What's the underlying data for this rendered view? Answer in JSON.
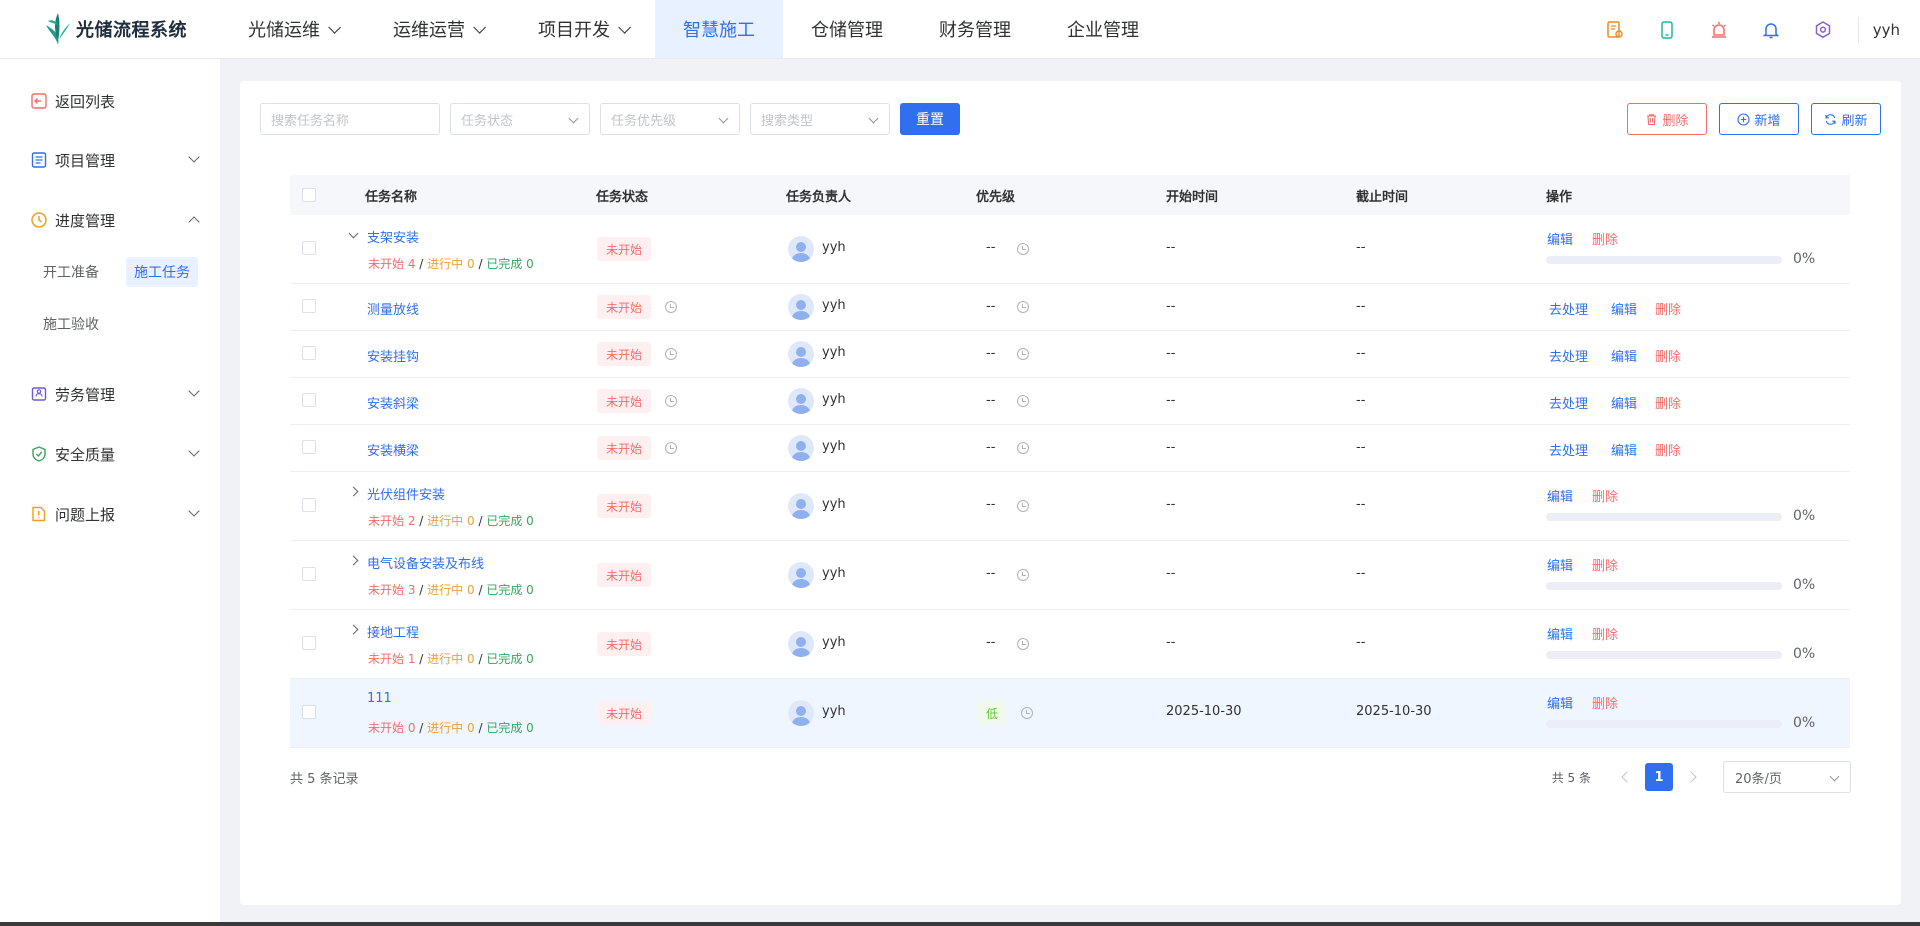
{
  "app": {
    "title": "光储流程系统",
    "user": "yyh"
  },
  "topnav": [
    {
      "label": "光储运维",
      "has_chevron": true
    },
    {
      "label": "运维运营",
      "has_chevron": true
    },
    {
      "label": "项目开发",
      "has_chevron": true
    },
    {
      "label": "智慧施工",
      "has_chevron": false,
      "active": true
    },
    {
      "label": "仓储管理",
      "has_chevron": false
    },
    {
      "label": "财务管理",
      "has_chevron": false
    },
    {
      "label": "企业管理",
      "has_chevron": false
    }
  ],
  "top_icons": [
    "map-pin-icon",
    "mobile-icon",
    "alarm-icon",
    "bell-icon",
    "settings-icon"
  ],
  "sidebar": {
    "back": "返回列表",
    "items": [
      {
        "label": "项目管理",
        "icon": "list-icon",
        "expanded": false
      },
      {
        "label": "进度管理",
        "icon": "clock-icon",
        "expanded": true
      },
      {
        "label": "劳务管理",
        "icon": "worker-icon",
        "expanded": false
      },
      {
        "label": "安全质量",
        "icon": "shield-icon",
        "expanded": false
      },
      {
        "label": "问题上报",
        "icon": "report-icon",
        "expanded": false
      }
    ],
    "sub_items": [
      {
        "label": "开工准备",
        "active": false
      },
      {
        "label": "施工任务",
        "active": true
      },
      {
        "label": "施工验收",
        "active": false
      }
    ]
  },
  "filters": {
    "task_name_placeholder": "搜索任务名称",
    "status_placeholder": "任务状态",
    "priority_placeholder": "任务优先级",
    "type_placeholder": "搜索类型",
    "reset_label": "重置"
  },
  "actions": {
    "delete": "删除",
    "add": "新增",
    "refresh": "刷新"
  },
  "table": {
    "headers": [
      "任务名称",
      "任务状态",
      "任务负责人",
      "优先级",
      "开始时间",
      "截止时间",
      "操作"
    ],
    "ops": {
      "handle": "去处理",
      "edit": "编辑",
      "delete": "删除"
    },
    "count_labels": {
      "not_started": "未开始",
      "in_progress": "进行中",
      "done": "已完成"
    },
    "rows": [
      {
        "name": "支架安装",
        "parent": true,
        "expander": "down",
        "status": "未开始",
        "owner": "yyh",
        "priority": "--",
        "start": "--",
        "end": "--",
        "not_started": "4",
        "in_progress": "0",
        "done": "0",
        "progress_pct": "0%",
        "progress": 0
      },
      {
        "name": "测量放线",
        "child": true,
        "status": "未开始",
        "owner": "yyh",
        "priority": "--",
        "start": "--",
        "end": "--"
      },
      {
        "name": "安装挂钩",
        "child": true,
        "status": "未开始",
        "owner": "yyh",
        "priority": "--",
        "start": "--",
        "end": "--"
      },
      {
        "name": "安装斜梁",
        "child": true,
        "status": "未开始",
        "owner": "yyh",
        "priority": "--",
        "start": "--",
        "end": "--"
      },
      {
        "name": "安装横梁",
        "child": true,
        "status": "未开始",
        "owner": "yyh",
        "priority": "--",
        "start": "--",
        "end": "--"
      },
      {
        "name": "光伏组件安装",
        "parent": true,
        "expander": "right",
        "status": "未开始",
        "owner": "yyh",
        "priority": "--",
        "start": "--",
        "end": "--",
        "not_started": "2",
        "in_progress": "0",
        "done": "0",
        "progress_pct": "0%",
        "progress": 0
      },
      {
        "name": "电气设备安装及布线",
        "parent": true,
        "expander": "right",
        "status": "未开始",
        "owner": "yyh",
        "priority": "--",
        "start": "--",
        "end": "--",
        "not_started": "3",
        "in_progress": "0",
        "done": "0",
        "progress_pct": "0%",
        "progress": 0
      },
      {
        "name": "接地工程",
        "parent": true,
        "expander": "right",
        "status": "未开始",
        "owner": "yyh",
        "priority": "--",
        "start": "--",
        "end": "--",
        "not_started": "1",
        "in_progress": "0",
        "done": "0",
        "progress_pct": "0%",
        "progress": 0
      },
      {
        "name": "111",
        "parent": true,
        "expander": "none",
        "highlight": true,
        "status": "未开始",
        "owner": "yyh",
        "priority": "低",
        "priority_tag": true,
        "start": "2025-10-30",
        "end": "2025-10-30",
        "not_started": "0",
        "in_progress": "0",
        "done": "0",
        "progress_pct": "0%",
        "progress": 0
      }
    ]
  },
  "footer": {
    "total_records": "共 5 条记录",
    "pager_total": "共 5 条",
    "current_page": "1",
    "page_size": "20条/页"
  },
  "colors": {
    "primary": "#2f6ff0",
    "danger": "#f56c6c",
    "warning": "#e6a23c",
    "success": "#3aa55b"
  }
}
